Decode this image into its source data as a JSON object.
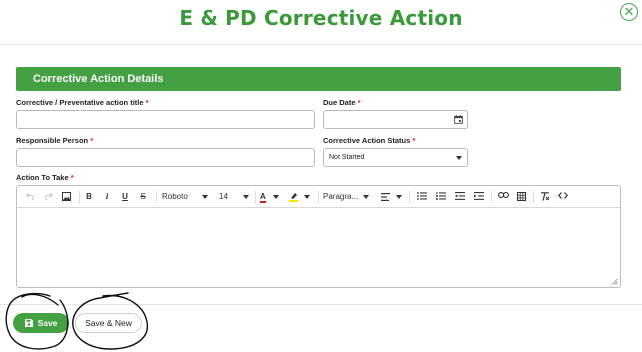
{
  "page": {
    "title": "E & PD Corrective Action",
    "close_icon": "circle-x-icon"
  },
  "section": {
    "title": "Corrective Action Details"
  },
  "fields": {
    "action_title_label": "Corrective / Preventative action title",
    "action_title_value": "",
    "due_date_label": "Due Date",
    "due_date_value": "",
    "responsible_label": "Responsible Person",
    "responsible_value": "",
    "status_label": "Corrective Action Status",
    "status_value": "Not Started",
    "action_to_take_label": "Action To Take",
    "action_to_take_value": "",
    "required_marker": "*"
  },
  "toolbar": {
    "undo_icon": "undo-icon",
    "redo_icon": "redo-icon",
    "image_icon": "image-icon",
    "bold": "B",
    "italic": "I",
    "underline": "U",
    "strike": "S",
    "font_family": "Roboto",
    "font_size": "14",
    "text_color_glyph": "A",
    "highlight_icon": "highlight-icon",
    "block_format": "Paragra...",
    "align_icon": "align-left-icon",
    "bullet_list_icon": "bullet-list-icon",
    "numbered_list_icon": "numbered-list-icon",
    "outdent_icon": "outdent-icon",
    "indent_icon": "indent-icon",
    "link_icon": "link-icon",
    "table_icon": "table-icon",
    "clear_format_icon": "clear-format-icon",
    "code_icon": "code-icon"
  },
  "buttons": {
    "save_label": "Save",
    "save_new_label": "Save & New"
  },
  "colors": {
    "brand_green": "#43a043",
    "title_green": "#3a9a3a",
    "required_red": "#d01f1f",
    "text_color_swatch": "#d01f1f",
    "highlight_swatch": "#f5e600"
  }
}
